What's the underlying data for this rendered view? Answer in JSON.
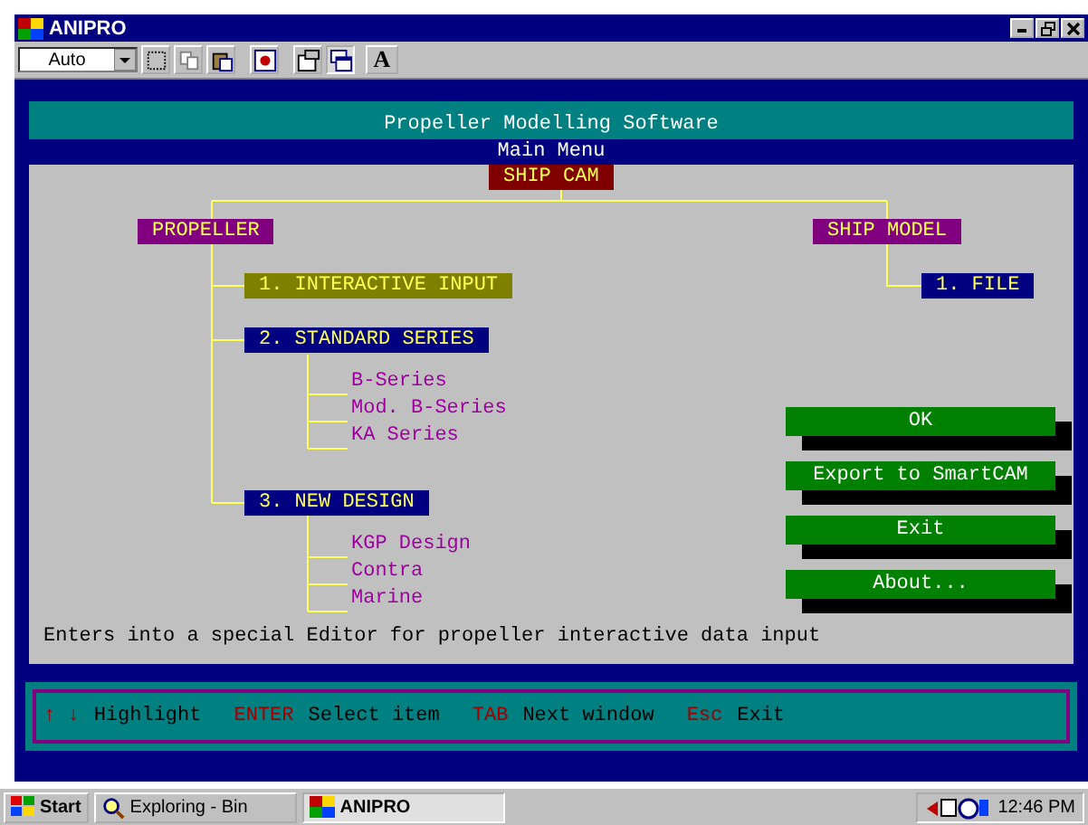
{
  "window": {
    "title": "ANIPRO"
  },
  "toolbar": {
    "font_size": "Auto",
    "font_button": "A"
  },
  "header": {
    "title": "Propeller Modelling Software",
    "subtitle": "Main Menu"
  },
  "tree": {
    "root": "SHIP CAM",
    "branches": [
      {
        "label": "PROPELLER",
        "children": [
          {
            "label": "1. INTERACTIVE INPUT",
            "selected": true
          },
          {
            "label": "2. STANDARD SERIES",
            "selected": false,
            "children": [
              "B-Series",
              "Mod. B-Series",
              "KA Series"
            ]
          },
          {
            "label": "3. NEW DESIGN",
            "selected": false,
            "children": [
              "KGP Design",
              "Contra",
              "Marine"
            ]
          }
        ]
      },
      {
        "label": "SHIP MODEL",
        "children": [
          {
            "label": "1. FILE",
            "selected": false
          }
        ]
      }
    ]
  },
  "buttons": [
    "OK",
    "Export to SmartCAM",
    "Exit",
    "About..."
  ],
  "status_message": "Enters into a special Editor for propeller interactive data input",
  "key_hints": [
    {
      "key": "↑ ↓",
      "action": "Highlight"
    },
    {
      "key": "ENTER",
      "action": "Select item"
    },
    {
      "key": "TAB",
      "action": "Next window"
    },
    {
      "key": "Esc",
      "action": "Exit"
    }
  ],
  "taskbar": {
    "start": "Start",
    "tasks": [
      {
        "label": "Exploring - Bin",
        "selected": false
      },
      {
        "label": "ANIPRO",
        "selected": true
      }
    ],
    "clock": "12:46 PM"
  }
}
